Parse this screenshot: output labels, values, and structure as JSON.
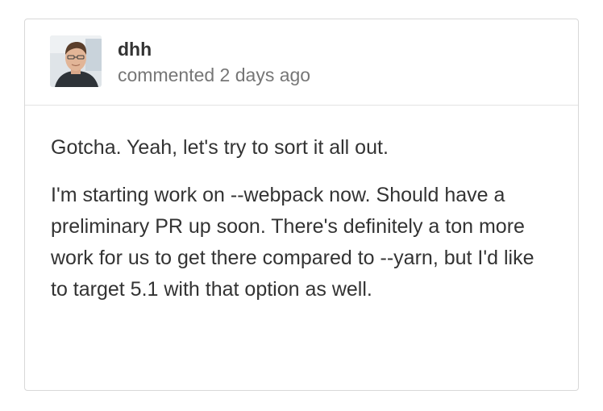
{
  "comment": {
    "author": "dhh",
    "meta": "commented 2 days ago",
    "avatar_icon": "user-avatar-photo",
    "paragraphs": [
      "Gotcha. Yeah, let's try to sort it all out.",
      "I'm starting work on --webpack now. Should have a preliminary PR up soon. There's definitely a ton more work for us to get there compared to --yarn, but I'd like to target 5.1 with that option as well."
    ]
  },
  "colors": {
    "border": "#d8d8d8",
    "text": "#333333",
    "meta_text": "#767676"
  }
}
